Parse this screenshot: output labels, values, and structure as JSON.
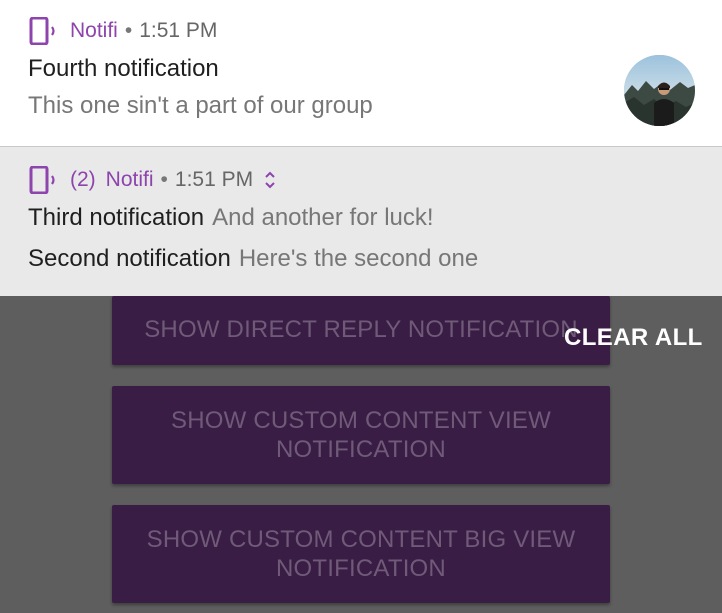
{
  "app": {
    "buttons": [
      {
        "label": "SHOW DIRECT REPLY NOTIFICATION"
      },
      {
        "label": "SHOW CUSTOM CONTENT VIEW NOTIFICATION"
      },
      {
        "label": "SHOW CUSTOM CONTENT BIG VIEW NOTIFICATION"
      }
    ]
  },
  "shade": {
    "clear_all_label": "CLEAR ALL"
  },
  "notifications": {
    "fourth": {
      "app_name": "Notifi",
      "separator": "•",
      "time": "1:51 PM",
      "title": "Fourth notification",
      "text": "This one sin't a part of our group",
      "icon": "phone-vibrate-icon",
      "avatar": "person-avatar"
    },
    "group": {
      "count": "(2)",
      "app_name": "Notifi",
      "separator": "•",
      "time": "1:51 PM",
      "icon": "phone-vibrate-icon",
      "expand_icon": "expand-icon",
      "lines": [
        {
          "title": "Third notification",
          "text": "And another for luck!"
        },
        {
          "title": "Second notification",
          "text": "Here's the second one"
        }
      ]
    }
  },
  "colors": {
    "accent": "#8e44ad",
    "button_bg": "#3a1d45",
    "scrim": "#5e5e5e",
    "notif_bg": "#ffffff",
    "group_bg": "#e9e9e9"
  }
}
